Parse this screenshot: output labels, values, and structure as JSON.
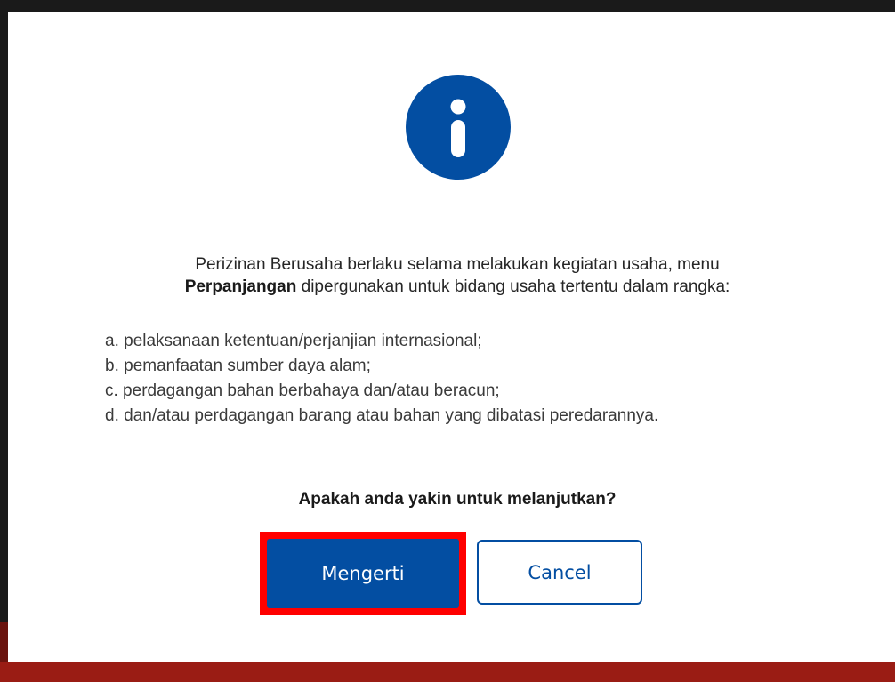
{
  "dialog": {
    "icon": "info-icon",
    "message_line1": "Perizinan Berusaha berlaku selama melakukan kegiatan usaha, menu",
    "message_bold": "Perpanjangan",
    "message_line2_rest": " dipergunakan untuk bidang usaha tertentu dalam rangka:",
    "list": [
      "a. pelaksanaan ketentuan/perjanjian internasional;",
      "b. pemanfaatan sumber daya alam;",
      "c. perdagangan bahan berbahaya dan/atau beracun;",
      "d. dan/atau perdagangan barang atau bahan yang dibatasi peredarannya."
    ],
    "question": "Apakah anda yakin untuk melanjutkan?",
    "confirm_label": "Mengerti",
    "cancel_label": "Cancel"
  },
  "colors": {
    "primary": "#034ea2",
    "highlight": "#ff0000",
    "footer_bar": "#9a1c14"
  }
}
